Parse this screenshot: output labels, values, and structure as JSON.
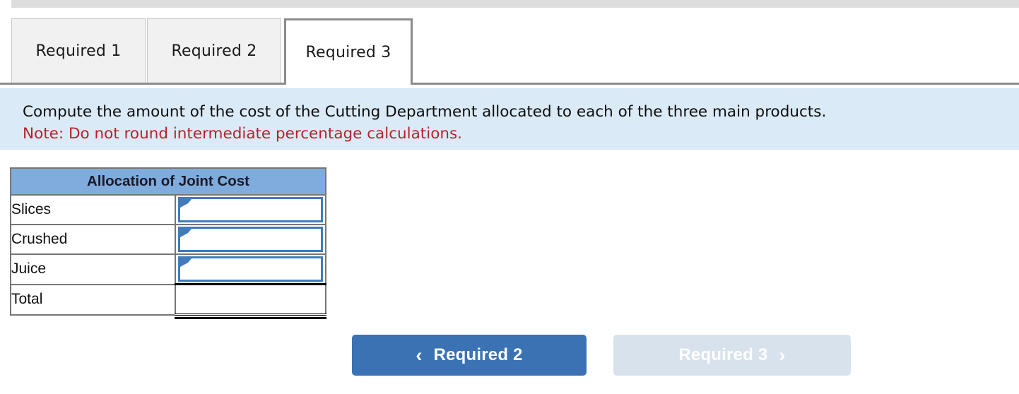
{
  "tabs": [
    {
      "label": "Required 1",
      "active": false
    },
    {
      "label": "Required 2",
      "active": false
    },
    {
      "label": "Required 3",
      "active": true
    }
  ],
  "instructions": {
    "prompt": "Compute the amount of the cost of the Cutting Department allocated to each of the three main products.",
    "note": "Note: Do not round intermediate percentage calculations."
  },
  "table": {
    "header": "Allocation of Joint Cost",
    "rows": [
      {
        "label": "Slices",
        "value": "",
        "input": true
      },
      {
        "label": "Crushed",
        "value": "",
        "input": true
      },
      {
        "label": "Juice",
        "value": "",
        "input": true
      },
      {
        "label": "Total",
        "value": "",
        "input": false
      }
    ]
  },
  "nav": {
    "prev_label": "Required 2",
    "prev_icon": "chevron-left",
    "prev_glyph": "‹",
    "next_label": "Required 3",
    "next_icon": "chevron-right",
    "next_glyph": "›",
    "next_disabled": true
  },
  "colors": {
    "header_blue": "#7fabdd",
    "instruction_bg": "#daeaf6",
    "note_red": "#b7222b",
    "primary_button": "#3a72b4",
    "disabled_button": "#d7e2ed",
    "input_border": "#3f7cbe",
    "top_strip": "#dededf"
  }
}
